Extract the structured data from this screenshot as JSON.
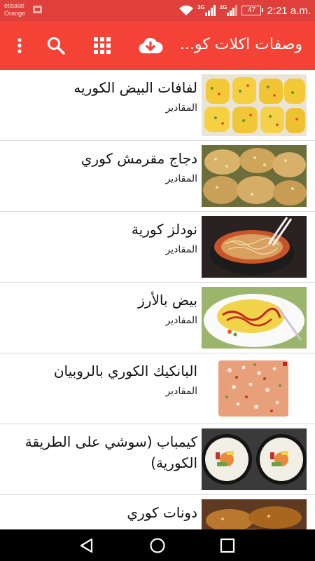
{
  "status_bar": {
    "carrier_line1": "etisalat",
    "carrier_line2": "Orange",
    "net_1": "3G",
    "net_2": "2G",
    "battery": "47",
    "time": "2:21 a.m.",
    "icons": [
      "notification-image-icon",
      "wifi-icon",
      "signal-icon",
      "battery-icon"
    ]
  },
  "app_bar": {
    "title": "وصفات اكلات كو...",
    "icons": [
      "download-cloud-icon",
      "grid-menu-icon",
      "search-icon",
      "overflow-menu-icon"
    ],
    "color": "#f44336"
  },
  "recipes": [
    {
      "title": "لفافات البيض الكوريه",
      "subtitle": "المقادير",
      "image": "egg-rolls"
    },
    {
      "title": "دجاج مقرمش كوري",
      "subtitle": "المقادير",
      "image": "crispy-chicken"
    },
    {
      "title": "نودلز كورية",
      "subtitle": "المقادير",
      "image": "noodles"
    },
    {
      "title": "بيض بالأرز",
      "subtitle": "المقادير",
      "image": "omurice"
    },
    {
      "title": "البانكيك الكوري بالروبيان",
      "subtitle": "المقادير",
      "image": "pancake"
    },
    {
      "title": "كيمباب (سوشي على الطريقة الكورية)",
      "subtitle": "",
      "image": "kimbap"
    },
    {
      "title": "دونات كوري",
      "subtitle": "",
      "image": "donuts"
    }
  ],
  "nav_bar": {
    "icons": [
      "back-icon",
      "home-icon",
      "recents-icon"
    ]
  }
}
